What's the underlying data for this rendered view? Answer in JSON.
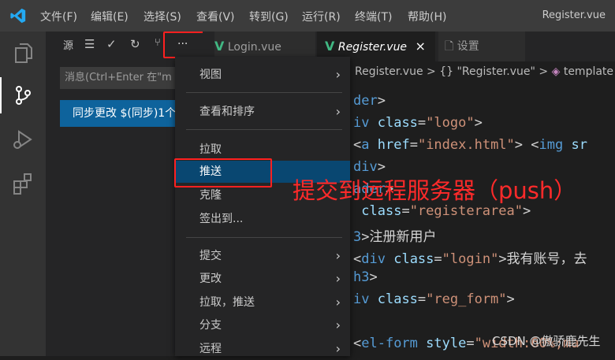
{
  "menubar": {
    "items": [
      "文件(F)",
      "编辑(E)",
      "选择(S)",
      "查看(V)",
      "转到(G)",
      "运行(R)",
      "终端(T)",
      "帮助(H)"
    ],
    "window_title": "Register.vue"
  },
  "scm": {
    "source_label": "源",
    "more_button": "···",
    "message_placeholder": "消息(Ctrl+Enter 在\"m",
    "sync_button": "同步更改 $(同步)1个"
  },
  "tabs": [
    {
      "label": "Login.vue",
      "icon": "vue-icon"
    },
    {
      "label": "Register.vue",
      "icon": "vue-icon",
      "active": true,
      "close": "×"
    },
    {
      "label": "设置",
      "icon": "file-icon"
    }
  ],
  "breadcrumb": {
    "file": "Register.vue",
    "sep": ">",
    "symbol1": "{} \"Register.vue\"",
    "symbol2": "template"
  },
  "context_menu": {
    "items": [
      {
        "label": "视图",
        "submenu": true
      },
      {
        "label": "查看和排序",
        "submenu": true
      },
      {
        "label": "拉取",
        "submenu": false
      },
      {
        "label": "推送",
        "submenu": false,
        "highlighted": true
      },
      {
        "label": "克隆",
        "submenu": false
      },
      {
        "label": "签出到...",
        "submenu": false
      },
      {
        "label": "提交",
        "submenu": true
      },
      {
        "label": "更改",
        "submenu": true
      },
      {
        "label": "拉取，推送",
        "submenu": true
      },
      {
        "label": "分支",
        "submenu": true
      },
      {
        "label": "远程",
        "submenu": true
      }
    ]
  },
  "annotation": "提交到远程服务器（push）",
  "watermark": "CSDN @傲骄鹿先生",
  "colors": {
    "accent": "#0e639c",
    "highlight": "#094771",
    "annotation": "#ff2a2a",
    "vue": "#41b883"
  }
}
